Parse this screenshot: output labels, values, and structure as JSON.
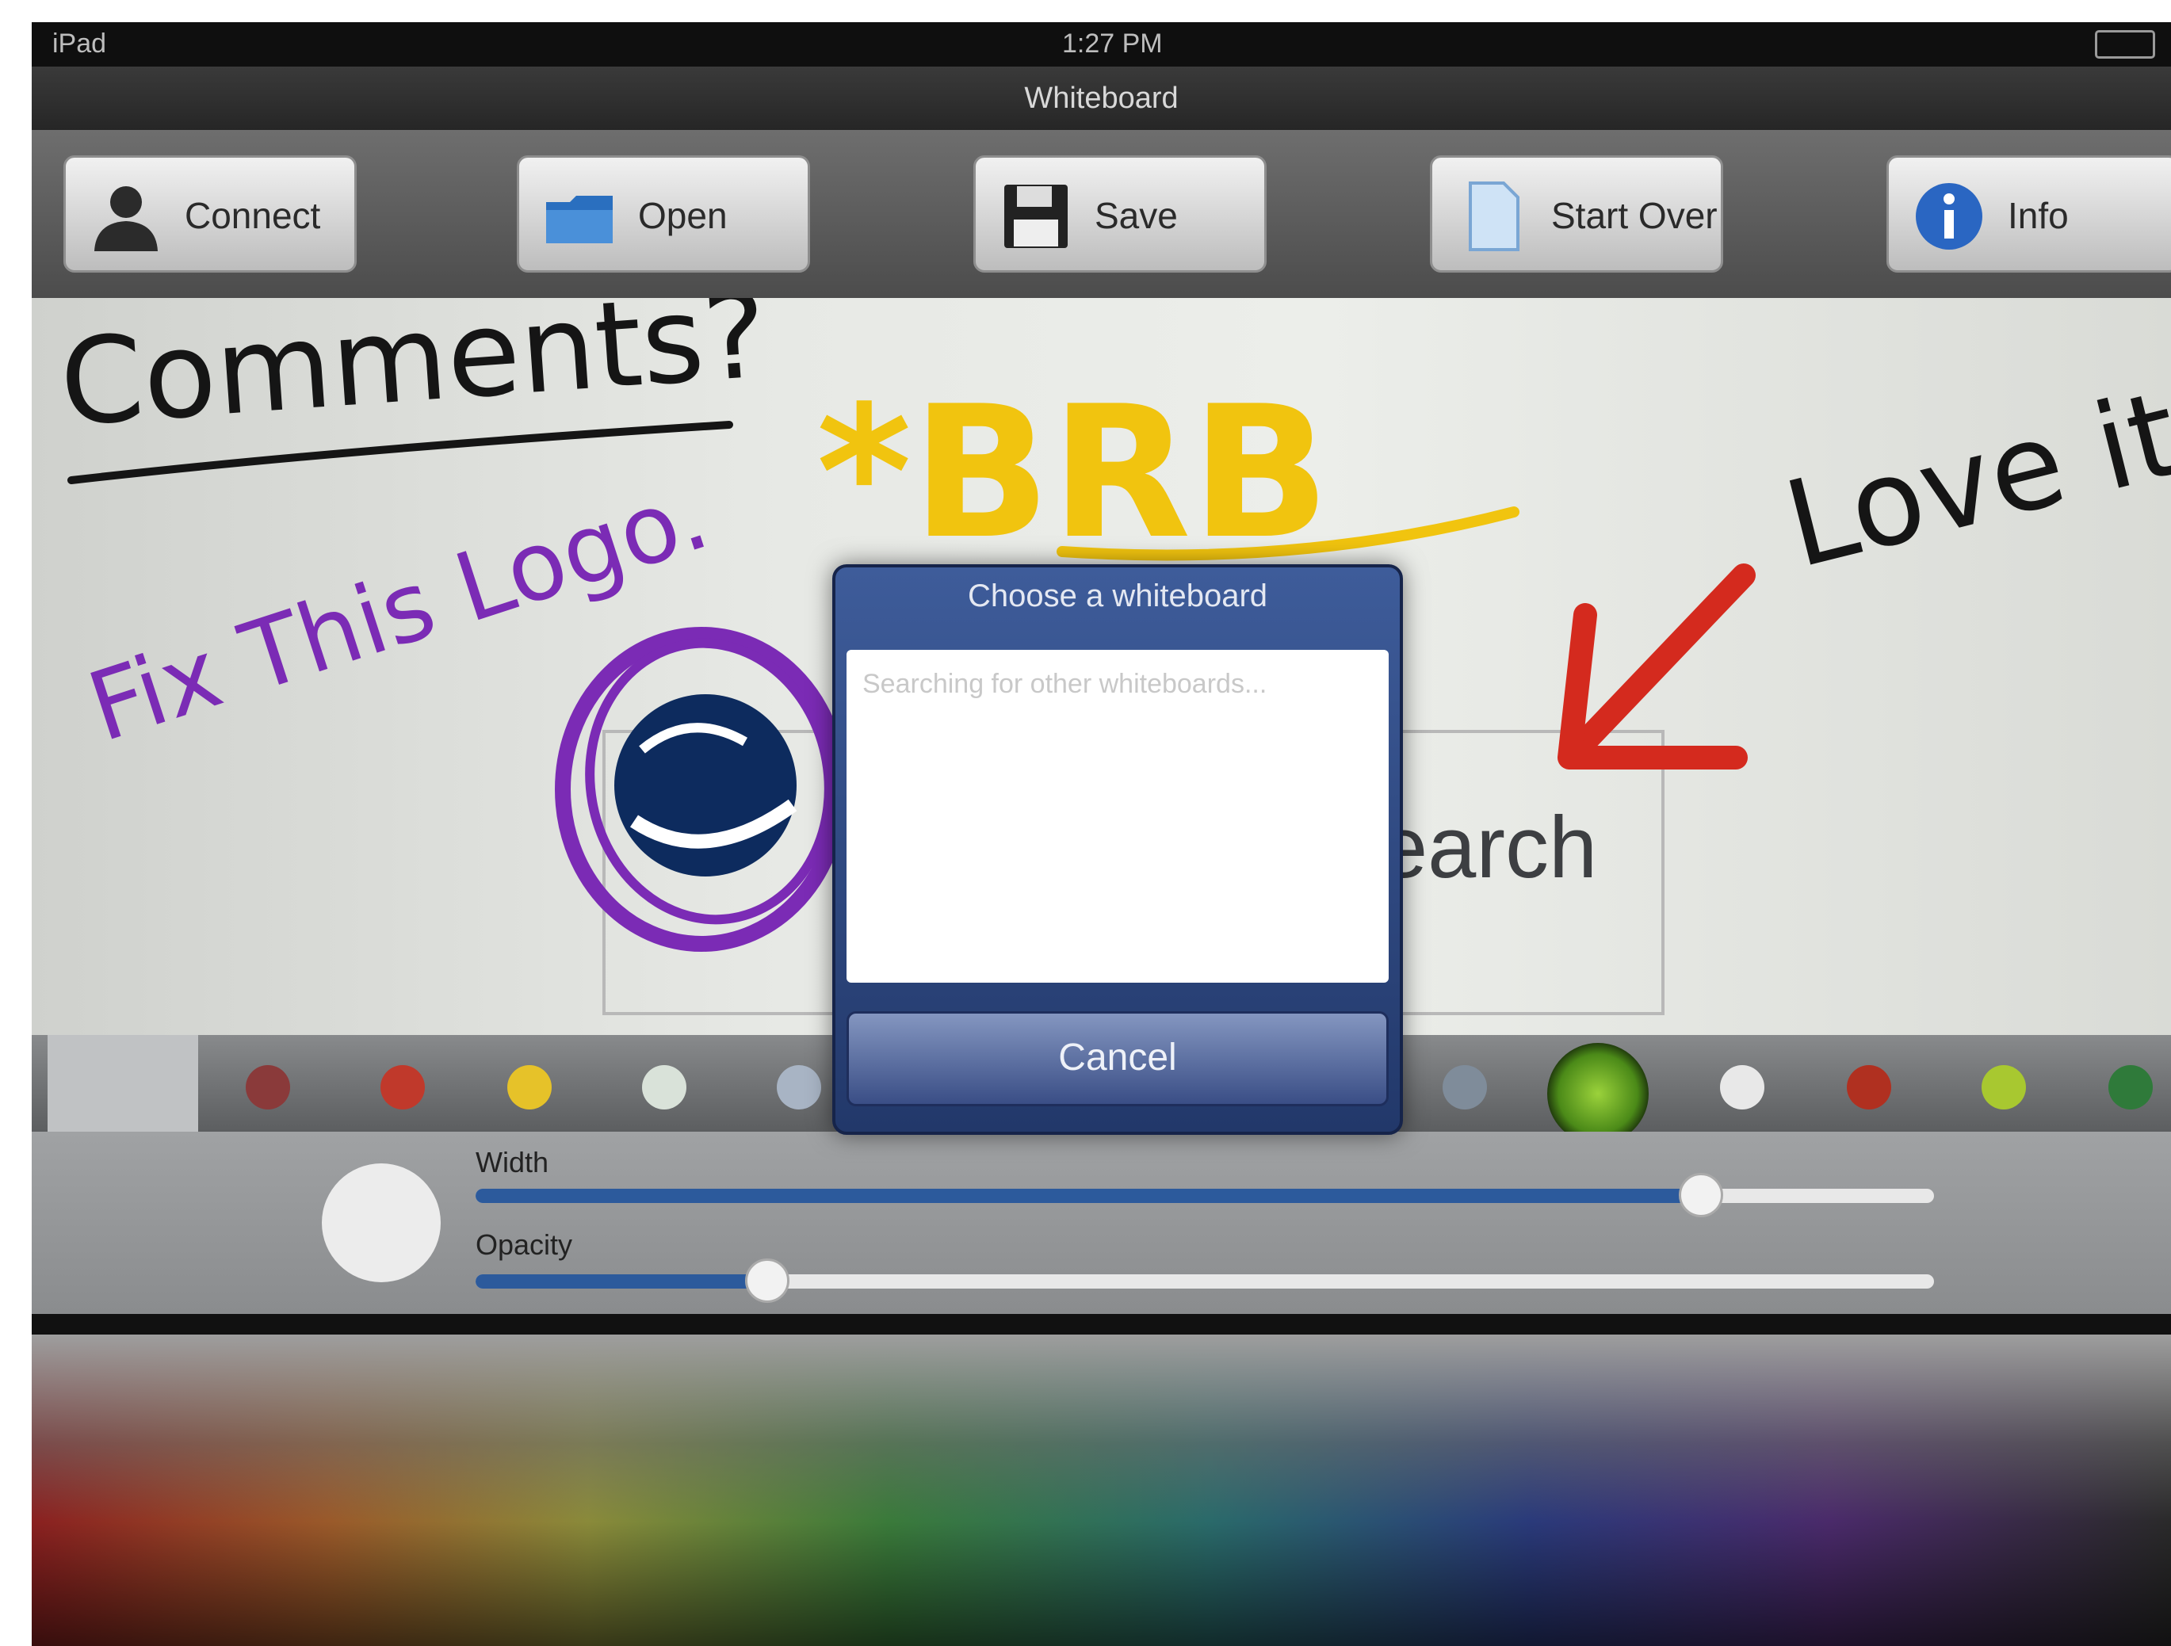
{
  "status_bar": {
    "carrier": "iPad",
    "time": "1:27 PM"
  },
  "title_bar": {
    "title": "Whiteboard"
  },
  "toolbar": {
    "buttons": [
      {
        "label": "Connect",
        "icon": "person-icon"
      },
      {
        "label": "Open",
        "icon": "folder-icon"
      },
      {
        "label": "Save",
        "icon": "floppy-disk-icon"
      },
      {
        "label": "Start Over",
        "icon": "new-page-icon"
      },
      {
        "label": "Info",
        "icon": "info-icon"
      }
    ]
  },
  "canvas": {
    "handwriting": {
      "comments": "Comments?",
      "brb": "*BRB",
      "love_it": "Love it.",
      "fix_logo": "Fix This Logo."
    },
    "page_text": "earch",
    "ink_colors": {
      "black": "#151515",
      "yellow": "#f1c40f",
      "purple": "#7b2bb5",
      "red": "#d42a1e"
    }
  },
  "palette": {
    "swatches": [
      "#8a3a3a",
      "#c0392b",
      "#e6c229",
      "#d9e2d9",
      "#a8b4c4",
      "#7f8c9a",
      "#e8e8e8",
      "#b03020",
      "#a8c830",
      "#2f7a3a"
    ],
    "active_color": "#6fb52a"
  },
  "controls": {
    "width_label": "Width",
    "opacity_label": "Opacity",
    "width_value": 0.84,
    "opacity_value": 0.2
  },
  "dialog": {
    "title": "Choose a whiteboard",
    "status": "Searching for other whiteboards...",
    "cancel_label": "Cancel"
  },
  "spectrum": {
    "label": ""
  }
}
